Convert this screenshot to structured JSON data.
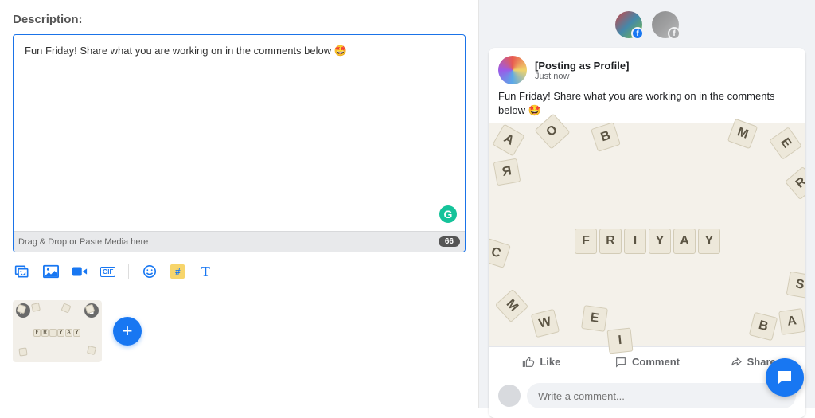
{
  "editor": {
    "label": "Description:",
    "text": "Fun Friday! Share what you are working on in the comments below 🤩",
    "dropzone_hint": "Drag & Drop or Paste Media here",
    "char_count": "66",
    "grammarly_glyph": "G"
  },
  "toolbar": {
    "gif_label": "GIF"
  },
  "add_button_glyph": "+",
  "preview": {
    "profile_name": "[Posting as Profile]",
    "timestamp": "Just now",
    "body_text": "Fun Friday! Share what you are working on in the comments below 🤩",
    "image_word": "FRIYAY",
    "actions": {
      "like": "Like",
      "comment": "Comment",
      "share": "Share"
    },
    "comment_placeholder": "Write a comment..."
  },
  "thumb_word": "FRIYAY"
}
